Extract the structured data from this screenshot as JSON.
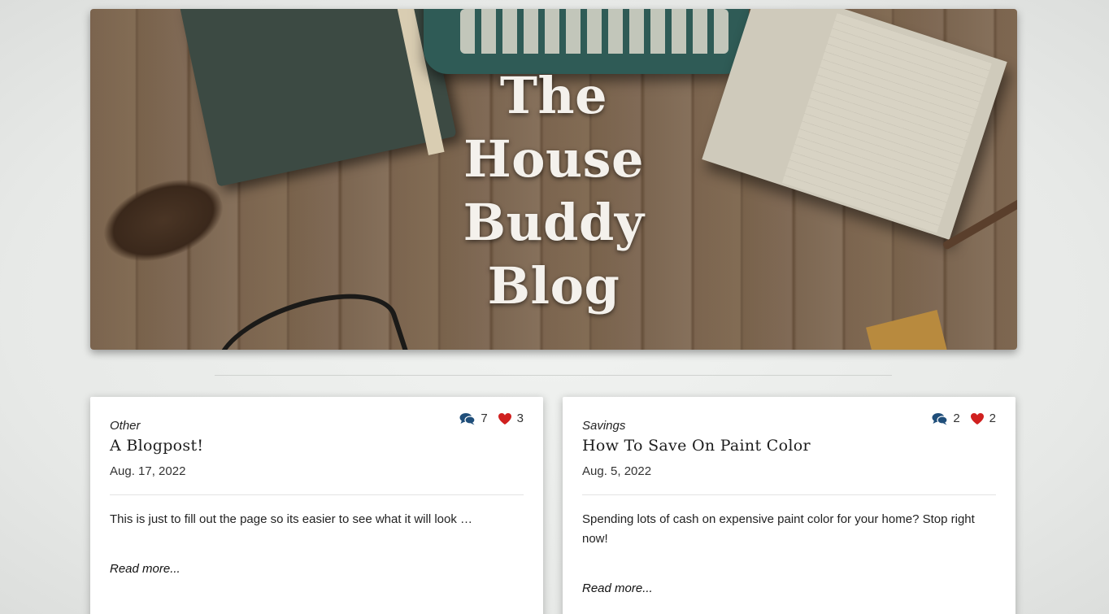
{
  "hero": {
    "title_lines": [
      "The",
      "House",
      "Buddy",
      "Blog"
    ]
  },
  "posts": [
    {
      "category": "Other",
      "title": "A Blogpost!",
      "date": "Aug. 17, 2022",
      "comments": "7",
      "likes": "3",
      "excerpt": "This is just to fill out the page so its easier to see what it will look …",
      "read_more": "Read more..."
    },
    {
      "category": "Savings",
      "title": "How To Save On Paint Color",
      "date": "Aug. 5, 2022",
      "comments": "2",
      "likes": "2",
      "excerpt": "Spending lots of cash on expensive paint color for your home? Stop right now!",
      "read_more": "Read more..."
    }
  ],
  "icons": {
    "comments": "comments-icon",
    "likes": "heart-icon"
  },
  "colors": {
    "comment_icon": "#1f4e7a",
    "heart_icon": "#d0201f",
    "title_text": "#f4f1ec"
  }
}
